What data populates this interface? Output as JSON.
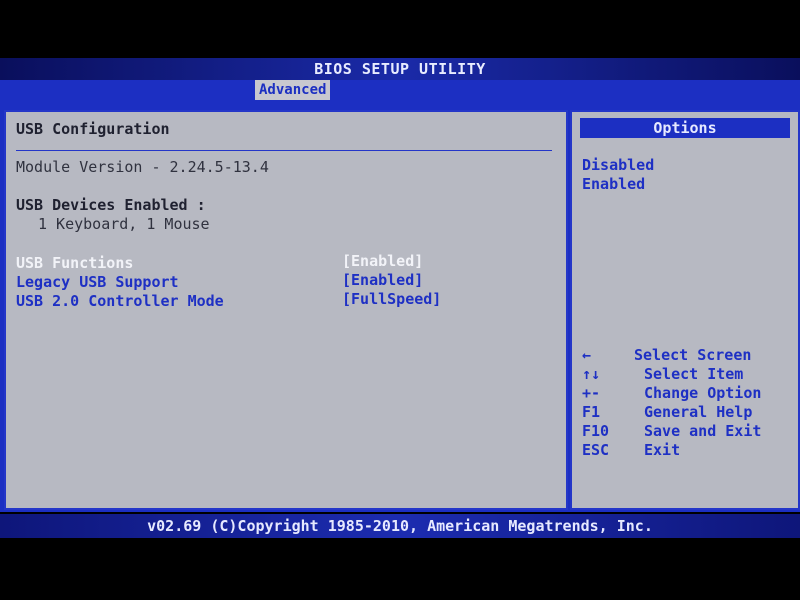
{
  "app_title": "BIOS SETUP UTILITY",
  "active_tab": "Advanced",
  "main": {
    "section_title": "USB Configuration",
    "module_version": "Module Version - 2.24.5-13.4",
    "devices_heading": "USB Devices Enabled :",
    "devices_value": "1 Keyboard, 1 Mouse",
    "settings": [
      {
        "label": "USB Functions",
        "value": "[Enabled]",
        "selected": true
      },
      {
        "label": "Legacy USB Support",
        "value": "[Enabled]",
        "selected": false
      },
      {
        "label": "USB 2.0 Controller Mode",
        "value": "[FullSpeed]",
        "selected": false
      }
    ]
  },
  "options": {
    "header": "Options",
    "items": [
      "Disabled",
      "Enabled"
    ]
  },
  "help": [
    {
      "key": "←",
      "action": "Select Screen"
    },
    {
      "key": "↑↓",
      "action": "Select Item"
    },
    {
      "key": "+-",
      "action": "Change Option"
    },
    {
      "key": "F1",
      "action": "General Help"
    },
    {
      "key": "F10",
      "action": "Save and Exit"
    },
    {
      "key": "ESC",
      "action": "Exit"
    }
  ],
  "footer": "v02.69 (C)Copyright 1985-2010, American Megatrends, Inc.",
  "colors": {
    "panel": "#b7b9c2",
    "frame_blue": "#1c2fc2",
    "highlight": "#f2f3f8",
    "item_text": "#1e30c4"
  }
}
